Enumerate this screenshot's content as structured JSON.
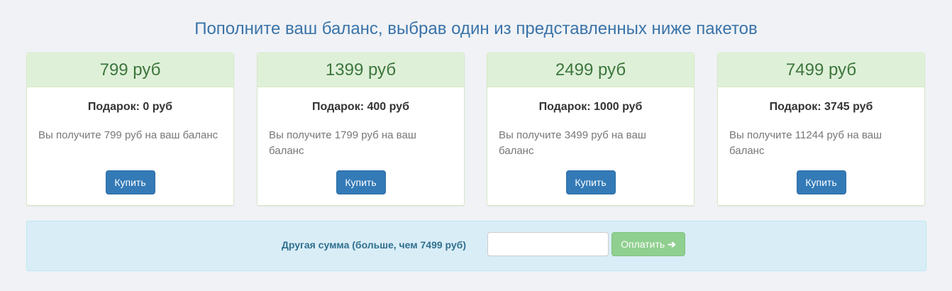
{
  "header": {
    "title": "Пополните ваш баланс, выбрав один из представленных ниже пакетов"
  },
  "packages": [
    {
      "price": "799 руб",
      "gift": "Подарок: 0 руб",
      "description": "Вы получите 799 руб на ваш баланс",
      "button": "Купить"
    },
    {
      "price": "1399 руб",
      "gift": "Подарок: 400 руб",
      "description": "Вы получите 1799 руб на ваш баланс",
      "button": "Купить"
    },
    {
      "price": "2499 руб",
      "gift": "Подарок: 1000 руб",
      "description": "Вы получите 3499 руб на ваш баланс",
      "button": "Купить"
    },
    {
      "price": "7499 руб",
      "gift": "Подарок: 3745 руб",
      "description": "Вы получите 11244 руб на ваш баланс",
      "button": "Купить"
    }
  ],
  "custom_amount": {
    "label": "Другая сумма (больше, чем 7499 руб)",
    "input_value": "",
    "pay_button": "Оплатить",
    "pay_icon": "arrow-right-icon"
  },
  "colors": {
    "title": "#3a73a9",
    "package_header_bg": "#dff0d8",
    "package_price": "#3c763d",
    "buy_button": "#337ab7",
    "pay_button": "#8fcf8f",
    "info_panel_bg": "#d9edf7"
  }
}
